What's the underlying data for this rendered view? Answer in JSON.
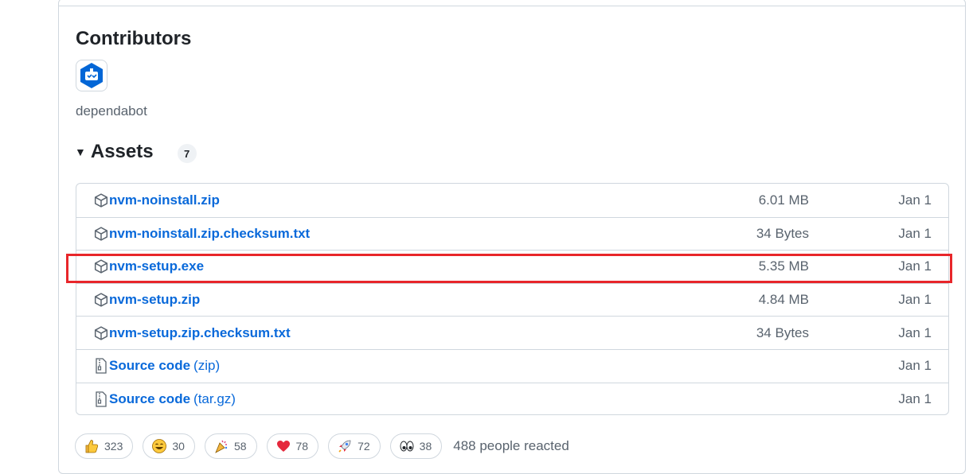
{
  "contributors": {
    "title": "Contributors",
    "users": [
      {
        "name": "dependabot"
      }
    ]
  },
  "assets": {
    "title": "Assets",
    "count": "7",
    "rows": [
      {
        "name": "nvm-noinstall.zip",
        "suffix": "",
        "size": "6.01 MB",
        "date": "Jan 1",
        "icon": "package-icon"
      },
      {
        "name": "nvm-noinstall.zip.checksum.txt",
        "suffix": "",
        "size": "34 Bytes",
        "date": "Jan 1",
        "icon": "package-icon"
      },
      {
        "name": "nvm-setup.exe",
        "suffix": "",
        "size": "5.35 MB",
        "date": "Jan 1",
        "icon": "package-icon"
      },
      {
        "name": "nvm-setup.zip",
        "suffix": "",
        "size": "4.84 MB",
        "date": "Jan 1",
        "icon": "package-icon"
      },
      {
        "name": "nvm-setup.zip.checksum.txt",
        "suffix": "",
        "size": "34 Bytes",
        "date": "Jan 1",
        "icon": "package-icon"
      },
      {
        "name": "Source code",
        "suffix": "(zip)",
        "size": "",
        "date": "Jan 1",
        "icon": "file-zip-icon"
      },
      {
        "name": "Source code",
        "suffix": "(tar.gz)",
        "size": "",
        "date": "Jan 1",
        "icon": "file-zip-icon"
      }
    ]
  },
  "reactions": {
    "items": [
      {
        "emoji": "thumbs-up-icon",
        "count": "323"
      },
      {
        "emoji": "laugh-icon",
        "count": "30"
      },
      {
        "emoji": "hooray-icon",
        "count": "58"
      },
      {
        "emoji": "heart-icon",
        "count": "78"
      },
      {
        "emoji": "rocket-icon",
        "count": "72"
      },
      {
        "emoji": "eyes-icon",
        "count": "38"
      }
    ],
    "summary": "488 people reacted"
  },
  "colors": {
    "link": "#0969da",
    "highlight": "#e8262a",
    "border": "#d0d7de",
    "muted": "#59636e"
  }
}
